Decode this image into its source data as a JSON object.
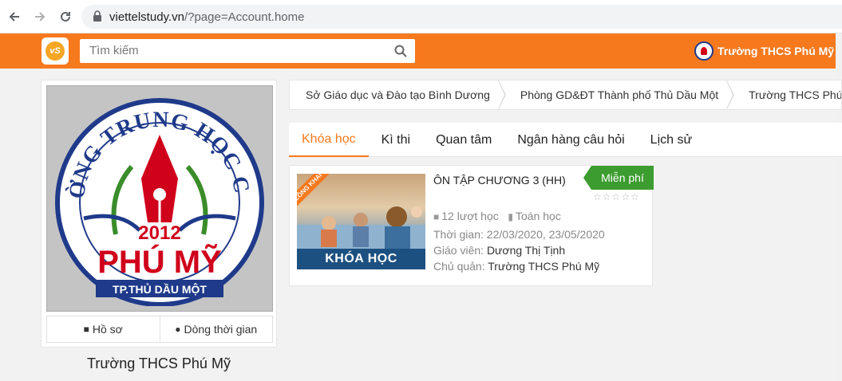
{
  "browser": {
    "url_host": "viettelstudy.vn",
    "url_path": "/?page=Account.home"
  },
  "header": {
    "logo_text": "vS",
    "search_placeholder": "Tìm kiếm",
    "school_name": "Trường THCS Phú Mỹ"
  },
  "profile": {
    "name": "Trường THCS Phú Mỹ",
    "crest": {
      "top_text": "TRƯỜNG TRUNG HỌC CƠ SỞ",
      "year": "2012",
      "name": "PHÚ MỸ",
      "city": "TP.THỦ DẦU MỘT"
    },
    "buttons": [
      {
        "label": "Hồ sơ",
        "icon": "user-icon"
      },
      {
        "label": "Dòng thời gian",
        "icon": "globe-icon"
      }
    ]
  },
  "breadcrumb": [
    "Sở Giáo dục và Đào tạo Bình Dương",
    "Phòng GD&ĐT Thành phố Thủ Dầu Một",
    "Trường THCS Phú Mỹ"
  ],
  "tabs": [
    {
      "label": "Khóa học",
      "active": true
    },
    {
      "label": "Kì thi",
      "active": false
    },
    {
      "label": "Quan tâm",
      "active": false
    },
    {
      "label": "Ngân hàng câu hỏi",
      "active": false
    },
    {
      "label": "Lịch sử",
      "active": false
    }
  ],
  "course": {
    "ribbon": "CÔNG KHAI",
    "thumb_label": "KHÓA HỌC",
    "title": "ÔN TẬP CHƯƠNG 3 (HH)",
    "badge": "Miễn phí",
    "rating": 0,
    "rating_max": 5,
    "learners": "12 lượt học",
    "subject": "Toán học",
    "time_label": "Thời gian:",
    "time_value": "22/03/2020, 23/05/2020",
    "teacher_label": "Giáo viên:",
    "teacher_value": "Dương Thị Tịnh",
    "owner_label": "Chủ quản:",
    "owner_value": "Trường THCS Phú Mỹ"
  },
  "colors": {
    "accent": "#f7791e",
    "badge_green": "#3c9c2f",
    "crest_blue": "#1f3a8a",
    "crest_red": "#d0021b"
  }
}
